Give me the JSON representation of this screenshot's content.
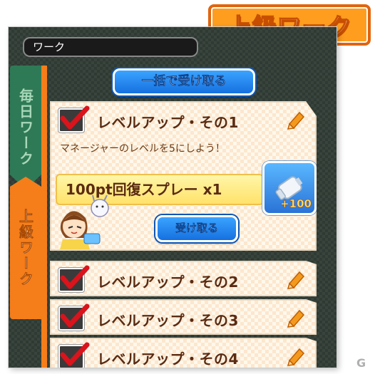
{
  "badge": {
    "text": "上級ワーク"
  },
  "header": {
    "title": "ワーク"
  },
  "tabs": [
    {
      "label": "毎日ワーク",
      "active": false
    },
    {
      "label": "上級ワーク",
      "active": true
    }
  ],
  "actions": {
    "collect_all_label": "一括で受け取る"
  },
  "tasks": [
    {
      "title": "レベルアップ・その1",
      "description": "マネージャーのレベルを5にしよう！",
      "reward": {
        "name": "100pt回復スプレー",
        "count": "x1",
        "badge_qty": "+100"
      },
      "receive_label": "受け取る"
    },
    {
      "title": "レベルアップ・その2"
    },
    {
      "title": "レベルアップ・その3"
    },
    {
      "title": "レベルアップ・その4"
    }
  ],
  "watermark": "G",
  "colors": {
    "tab_active": "#f57e1a",
    "tab_inactive": "#2f7a56",
    "button_blue": "#1670e0",
    "badge_orange": "#ff9d1e",
    "card_title": "#5a2b12"
  },
  "icons": [
    "check-icon",
    "pencil-icon",
    "spray-item-icon",
    "mascot-icon"
  ]
}
